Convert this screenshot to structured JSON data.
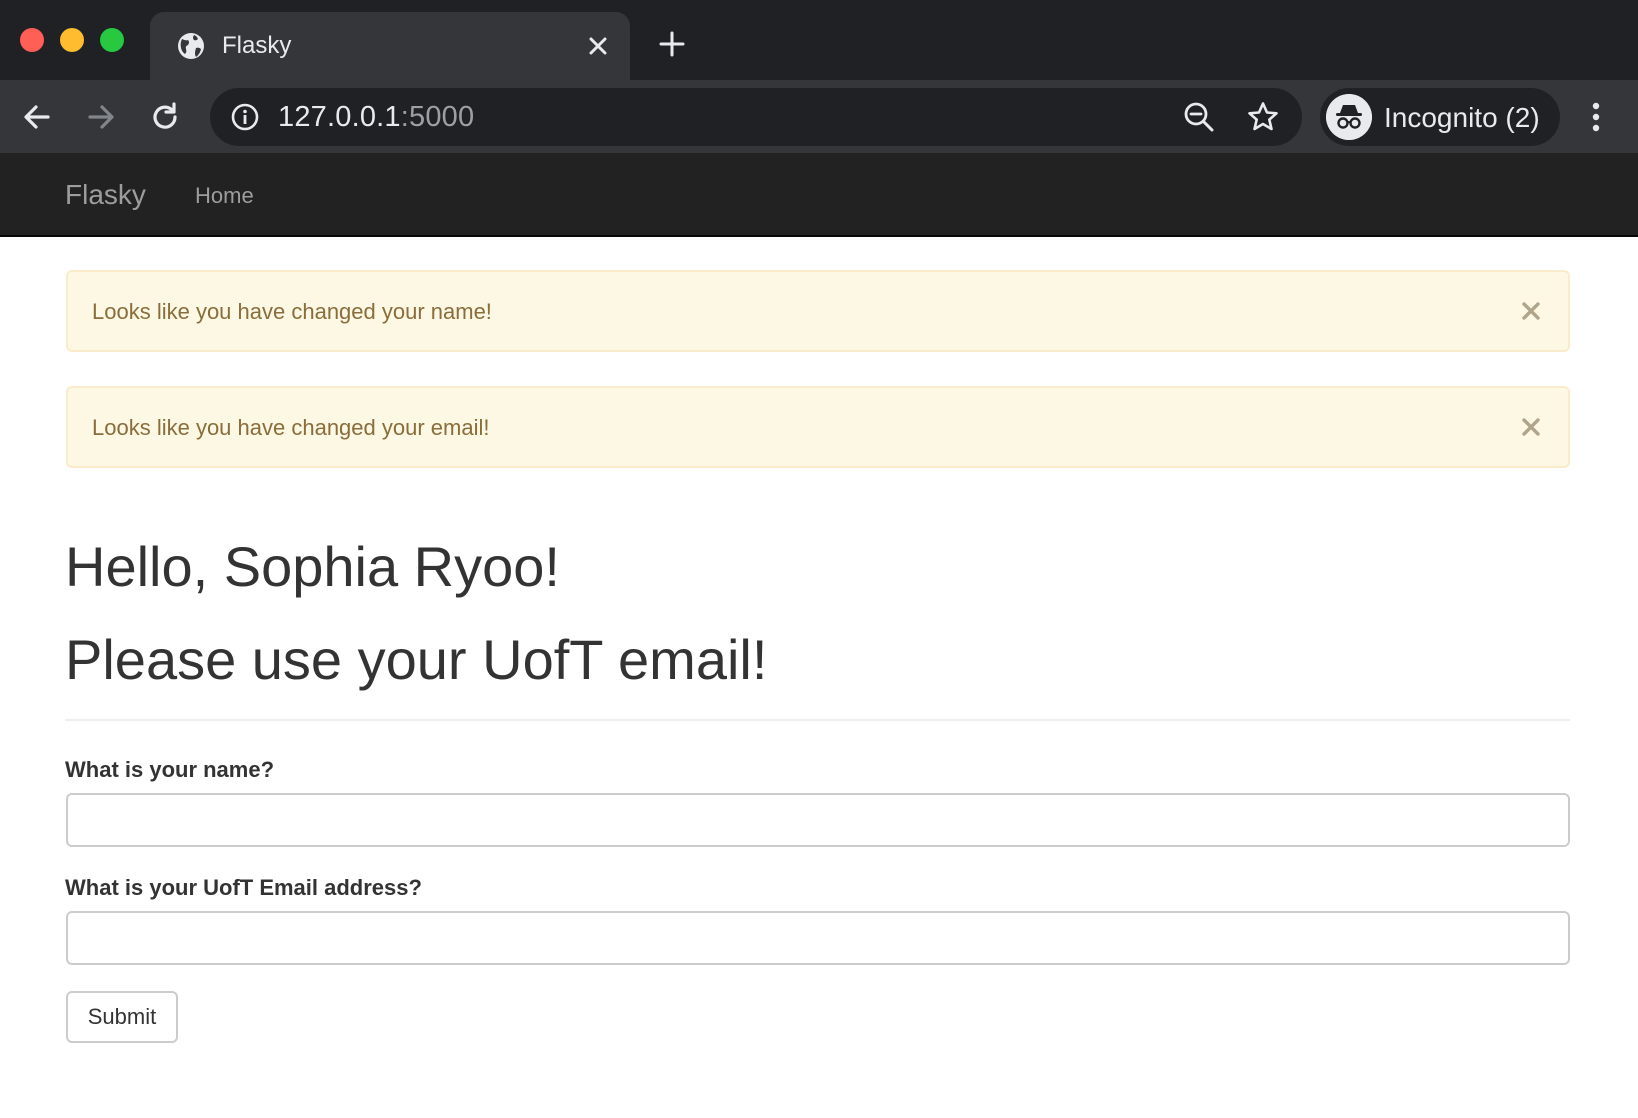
{
  "browser": {
    "tab": {
      "title": "Flasky",
      "icon": "globe-icon"
    },
    "new_tab_icon": "plus-icon",
    "address": {
      "host": "127.0.0.1",
      "port": ":5000"
    },
    "profile": {
      "label": "Incognito (2)",
      "icon": "incognito-icon"
    },
    "window_controls": [
      "close",
      "minimize",
      "zoom"
    ],
    "colors": {
      "tabstrip": "#202124",
      "toolbar": "#35363a",
      "text": "#e8eaed"
    }
  },
  "navbar": {
    "brand": "Flasky",
    "links": [
      {
        "label": "Home"
      }
    ]
  },
  "alerts": [
    {
      "text": "Looks like you have changed your name!"
    },
    {
      "text": "Looks like you have changed your email!"
    }
  ],
  "main": {
    "greeting": "Hello, Sophia Ryoo!",
    "notice": "Please use your UofT email!"
  },
  "form": {
    "name_label": "What is your name?",
    "name_value": "",
    "email_label": "What is your UofT Email address?",
    "email_value": "",
    "submit_label": "Submit"
  },
  "theme": {
    "alert_bg": "#fcf8e3",
    "alert_border": "#faebcc",
    "alert_text": "#8a6d3b",
    "navbar_bg": "#222222"
  }
}
